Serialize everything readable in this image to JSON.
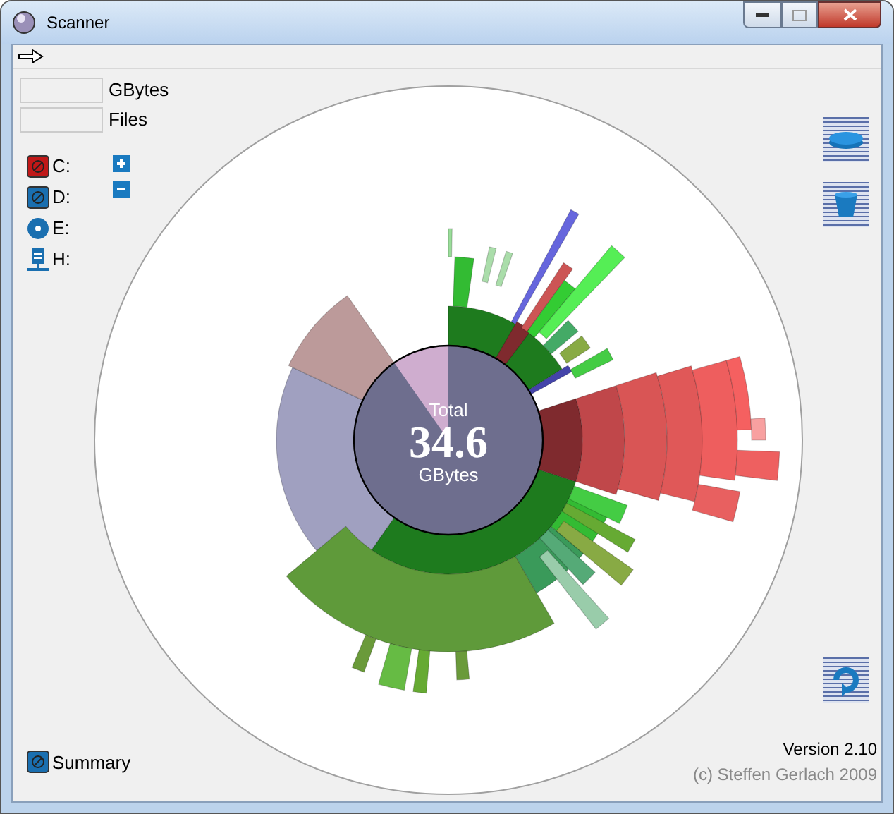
{
  "window": {
    "title": "Scanner"
  },
  "stats": [
    {
      "label": "GBytes"
    },
    {
      "label": "Files"
    }
  ],
  "drives": [
    {
      "label": "C:",
      "kind": "drive",
      "color": "#c01818"
    },
    {
      "label": "D:",
      "kind": "drive",
      "color": "#1a6fb0"
    },
    {
      "label": "E:",
      "kind": "disc"
    },
    {
      "label": "H:",
      "kind": "network"
    }
  ],
  "chart_center": {
    "caption": "Total",
    "value": "34.6",
    "unit": "GBytes"
  },
  "summary": {
    "label": "Summary"
  },
  "footer": {
    "version": "Version 2.10",
    "copyright": "(c) Steffen Gerlach 2009"
  }
}
